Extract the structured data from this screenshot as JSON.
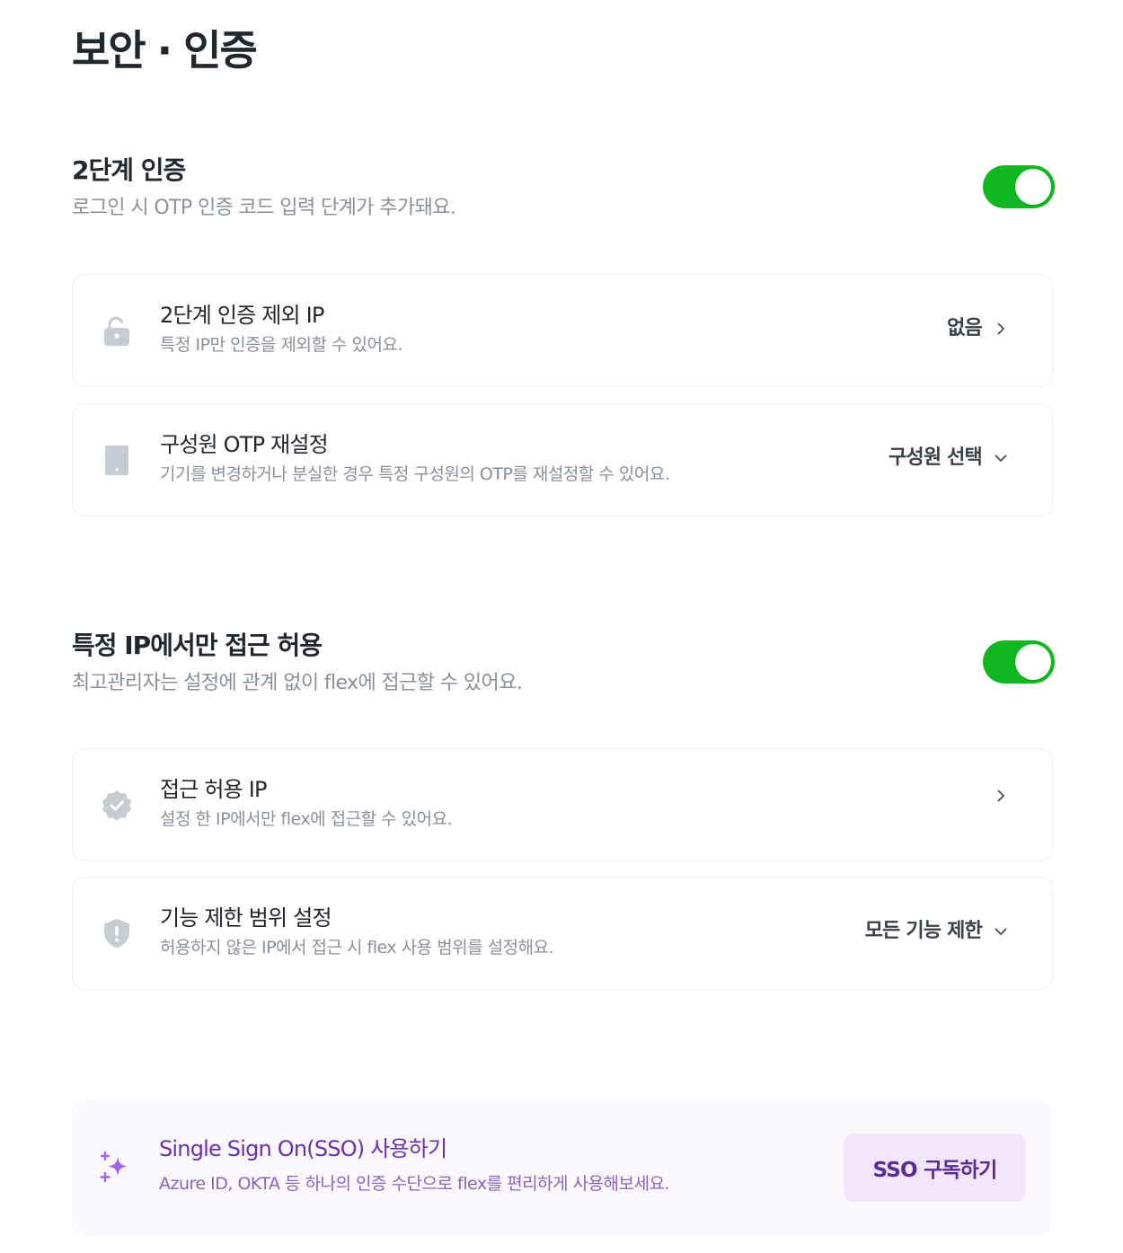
{
  "page": {
    "title": "보안 · 인증"
  },
  "colors": {
    "toggle_on": "#10b81f",
    "accent_purple": "#6a2fb0",
    "muted_text": "#8a9099",
    "icon_gray": "#c7ccd3"
  },
  "two_factor": {
    "title": "2단계 인증",
    "description": "로그인 시 OTP 인증 코드 입력 단계가 추가돼요.",
    "toggle_on": true,
    "items": [
      {
        "icon": "unlock-icon",
        "title": "2단계 인증 제외 IP",
        "description": "특정 IP만 인증을 제외할 수 있어요.",
        "action_label": "없음",
        "action_icon": "chevron-right-icon"
      },
      {
        "icon": "device-icon",
        "title": "구성원 OTP 재설정",
        "description": "기기를 변경하거나 분실한 경우 특정 구성원의 OTP를 재설정할 수 있어요.",
        "action_label": "구성원 선택",
        "action_icon": "chevron-down-icon"
      }
    ]
  },
  "ip_restriction": {
    "title": "특정 IP에서만 접근 허용",
    "description": "최고관리자는 설정에 관계 없이 flex에 접근할 수 있어요.",
    "toggle_on": true,
    "items": [
      {
        "icon": "verified-badge-icon",
        "title": "접근 허용 IP",
        "description": "설정 한 IP에서만 flex에 접근할 수 있어요.",
        "action_label": "",
        "action_icon": "chevron-right-icon"
      },
      {
        "icon": "shield-alert-icon",
        "title": "기능 제한 범위 설정",
        "description": "허용하지 않은 IP에서 접근 시 flex 사용 범위를 설정해요.",
        "action_label": "모든 기능 제한",
        "action_icon": "chevron-down-icon"
      }
    ]
  },
  "sso": {
    "icon": "sparkles-icon",
    "title": "Single Sign On(SSO) 사용하기",
    "description": "Azure ID, OKTA 등 하나의 인증 수단으로 flex를 편리하게 사용해보세요.",
    "button_label": "SSO 구독하기"
  }
}
